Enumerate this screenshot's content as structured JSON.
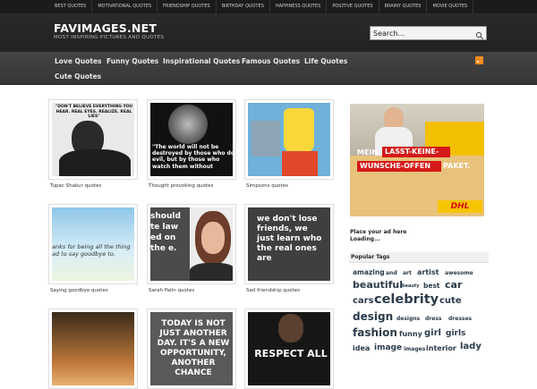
{
  "topbar": {
    "links": [
      "Best Quotes",
      "Motivational Quotes",
      "Friendship Quotes",
      "Birthday Quotes",
      "Happiness Quotes",
      "Positive Quotes",
      "Brainy Quotes",
      "Movie Quotes"
    ]
  },
  "header": {
    "title": "FAVIMAGES.NET",
    "tagline": "MOST INSPIRING PICTURES AND QUOTES",
    "search_value": "Search..."
  },
  "nav": {
    "items": [
      "Love Quotes",
      "Funny Quotes",
      "Inspirational Quotes",
      "Famous Quotes",
      "Life Quotes",
      "Cute Quotes"
    ]
  },
  "gallery": {
    "items": [
      {
        "caption": "Tupac Shakur quotes",
        "text": "\"DON'T BELIEVE EVERYTHING YOU HEAR. REAL EYES. REALIZE. REAL LIES\""
      },
      {
        "caption": "Thought provoking quotes",
        "text": "\"The world will not be destroyed by those who do evil, but by those who watch them without"
      },
      {
        "caption": "Simpsons quotes",
        "text": ""
      },
      {
        "caption": "Saying goodbye quotes",
        "text": "anks for being all the thing ad to say goodbye to."
      },
      {
        "caption": "Sarah Palin quotes",
        "text": "should te law ed on the e."
      },
      {
        "caption": "Sad friendship quotes",
        "text": "we don't lose friends, we just learn who the real ones are"
      },
      {
        "caption": "",
        "text": ""
      },
      {
        "caption": "",
        "text": "TODAY IS NOT JUST ANOTHER DAY. IT'S A NEW OPPORTUNITY, ANOTHER CHANCE"
      },
      {
        "caption": "",
        "text": "RESPECT ALL"
      }
    ]
  },
  "ad": {
    "line1": "MEIN",
    "line2": "LASST-KEINE-",
    "line3": "WUNSCHE-OFFEN",
    "line4": "PAKET.",
    "brand": "DHL"
  },
  "sidebar": {
    "place_ad": "Place your ad here",
    "loading": "Loading...",
    "popular_tags_title": "Popular Tags"
  },
  "tags": [
    "amazing",
    "and",
    "art",
    "artist",
    "awesome",
    "beautiful",
    "beauty",
    "best",
    "car",
    "cars",
    "celebrity",
    "cute",
    "design",
    "designs",
    "dress",
    "dresses",
    "fashion",
    "funny",
    "girl",
    "girls",
    "idea",
    "image",
    "images",
    "interior",
    "lady"
  ]
}
